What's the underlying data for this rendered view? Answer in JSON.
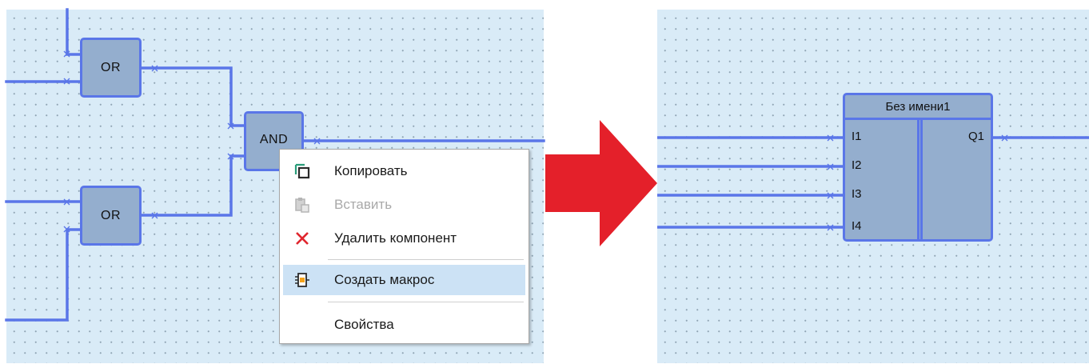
{
  "left_canvas": {
    "blocks": [
      {
        "label": "OR"
      },
      {
        "label": "AND"
      },
      {
        "label": "OR"
      }
    ]
  },
  "context_menu": {
    "items": [
      {
        "label": "Копировать",
        "icon": "copy-icon",
        "disabled": false
      },
      {
        "label": "Вставить",
        "icon": "paste-icon",
        "disabled": true
      },
      {
        "label": "Удалить компонент",
        "icon": "delete-icon",
        "disabled": false
      },
      {
        "label": "Создать макрос",
        "icon": "macro-icon",
        "disabled": false,
        "highlighted": true
      },
      {
        "label": "Свойства",
        "icon": "",
        "disabled": false
      }
    ]
  },
  "arrow": {
    "color": "#e4202a"
  },
  "right_canvas": {
    "macro_block": {
      "title": "Без имени1",
      "inputs": [
        "I1",
        "I2",
        "I3",
        "I4"
      ],
      "outputs": [
        "Q1"
      ]
    }
  },
  "colors": {
    "canvas": "#d9ebf7",
    "wire": "#5a76e8",
    "block_fill": "#94aece",
    "menu_highlight": "#cce2f5"
  }
}
